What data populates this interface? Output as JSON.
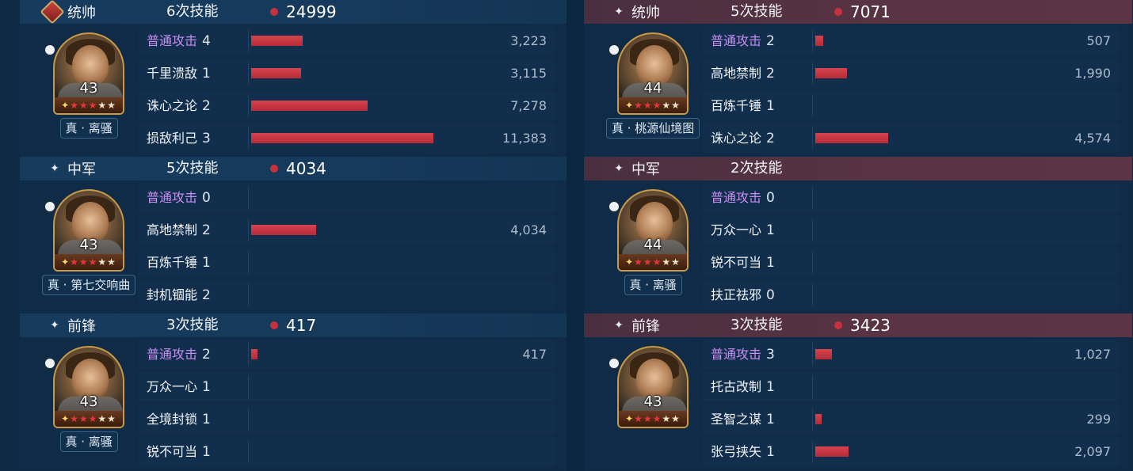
{
  "max_damage": 11383,
  "colors": {
    "bar": "#c7313c",
    "normal_attack": "#c98cf0",
    "star_red": "#e8353a",
    "star_white": "#f3e6c6"
  },
  "left": [
    {
      "role": "统帅",
      "role_icon": "commander-badge-icon",
      "casts": "6次技能",
      "damage": "24999",
      "level": "43",
      "tactic": "真 · 离骚",
      "skills": [
        {
          "name": "普通攻击",
          "count": "4",
          "value": "3,223",
          "damage": 3223,
          "normal": true
        },
        {
          "name": "千里溃敌",
          "count": "1",
          "value": "3,115",
          "damage": 3115
        },
        {
          "name": "诛心之论",
          "count": "2",
          "value": "7,278",
          "damage": 7278
        },
        {
          "name": "损敌利己",
          "count": "3",
          "value": "11,383",
          "damage": 11383
        }
      ]
    },
    {
      "role": "中军",
      "role_icon": "sparkle-icon",
      "casts": "5次技能",
      "damage": "4034",
      "level": "43",
      "tactic": "真 · 第七交响曲",
      "skills": [
        {
          "name": "普通攻击",
          "count": "0",
          "value": "",
          "damage": 0,
          "normal": true
        },
        {
          "name": "高地禁制",
          "count": "2",
          "value": "4,034",
          "damage": 4034
        },
        {
          "name": "百炼千锤",
          "count": "1",
          "value": "",
          "damage": 0
        },
        {
          "name": "封机锢能",
          "count": "2",
          "value": "",
          "damage": 0
        }
      ]
    },
    {
      "role": "前锋",
      "role_icon": "sparkle-icon",
      "casts": "3次技能",
      "damage": "417",
      "level": "43",
      "tactic": "真 · 离骚",
      "skills": [
        {
          "name": "普通攻击",
          "count": "2",
          "value": "417",
          "damage": 417,
          "normal": true
        },
        {
          "name": "万众一心",
          "count": "1",
          "value": "",
          "damage": 0
        },
        {
          "name": "全境封锁",
          "count": "1",
          "value": "",
          "damage": 0
        },
        {
          "name": "锐不可当",
          "count": "1",
          "value": "",
          "damage": 0
        }
      ]
    }
  ],
  "right": [
    {
      "role": "统帅",
      "role_icon": "sparkle-icon",
      "casts": "5次技能",
      "damage": "7071",
      "level": "44",
      "tactic": "真 · 桃源仙境图",
      "skills": [
        {
          "name": "普通攻击",
          "count": "2",
          "value": "507",
          "damage": 507,
          "normal": true
        },
        {
          "name": "高地禁制",
          "count": "2",
          "value": "1,990",
          "damage": 1990
        },
        {
          "name": "百炼千锤",
          "count": "1",
          "value": "",
          "damage": 0
        },
        {
          "name": "诛心之论",
          "count": "2",
          "value": "4,574",
          "damage": 4574
        }
      ]
    },
    {
      "role": "中军",
      "role_icon": "sparkle-icon",
      "casts": "2次技能",
      "damage": "",
      "level": "44",
      "tactic": "真 · 离骚",
      "skills": [
        {
          "name": "普通攻击",
          "count": "0",
          "value": "",
          "damage": 0,
          "normal": true
        },
        {
          "name": "万众一心",
          "count": "1",
          "value": "",
          "damage": 0
        },
        {
          "name": "锐不可当",
          "count": "1",
          "value": "",
          "damage": 0
        },
        {
          "name": "扶正祛邪",
          "count": "0",
          "value": "",
          "damage": 0
        }
      ]
    },
    {
      "role": "前锋",
      "role_icon": "sparkle-icon",
      "casts": "3次技能",
      "damage": "3423",
      "level": "43",
      "tactic": "",
      "skills": [
        {
          "name": "普通攻击",
          "count": "3",
          "value": "1,027",
          "damage": 1027,
          "normal": true
        },
        {
          "name": "托古改制",
          "count": "1",
          "value": "",
          "damage": 0
        },
        {
          "name": "圣智之谋",
          "count": "1",
          "value": "299",
          "damage": 299
        },
        {
          "name": "张弓挟矢",
          "count": "1",
          "value": "2,097",
          "damage": 2097
        }
      ]
    }
  ]
}
